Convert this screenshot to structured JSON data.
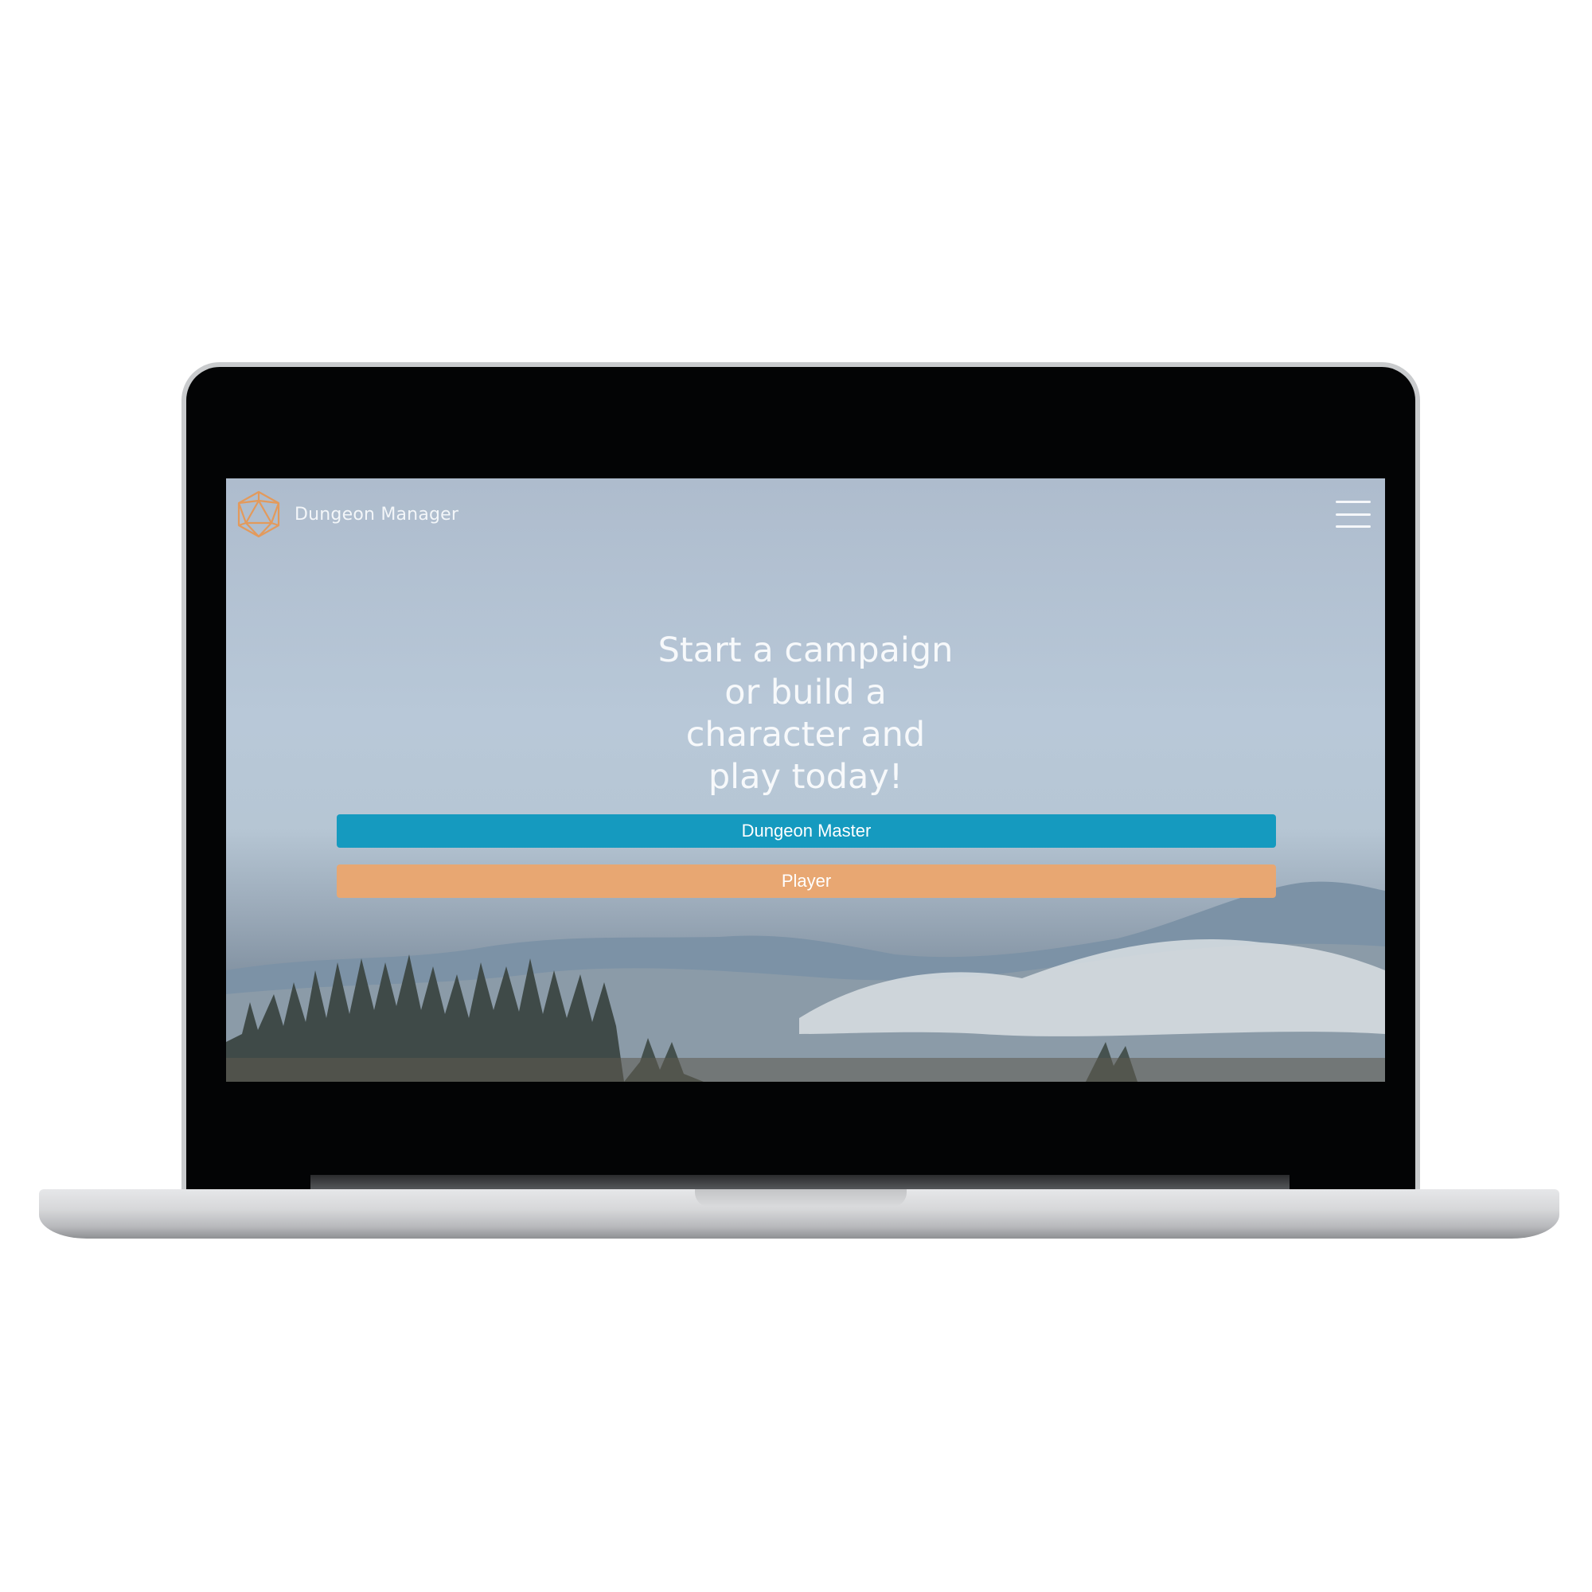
{
  "app": {
    "brand_name": "Dungeon Manager",
    "logo_icon": "d20-icon",
    "menu_icon": "hamburger-menu-icon"
  },
  "hero": {
    "title_lines": [
      "Start a campaign",
      "or build a",
      "character and",
      "play today!"
    ]
  },
  "actions": {
    "dungeon_master_label": "Dungeon Master",
    "player_label": "Player"
  },
  "colors": {
    "dungeon_master_button": "#159abf",
    "player_button": "#e8a772",
    "logo_accent": "#e39a5c"
  }
}
